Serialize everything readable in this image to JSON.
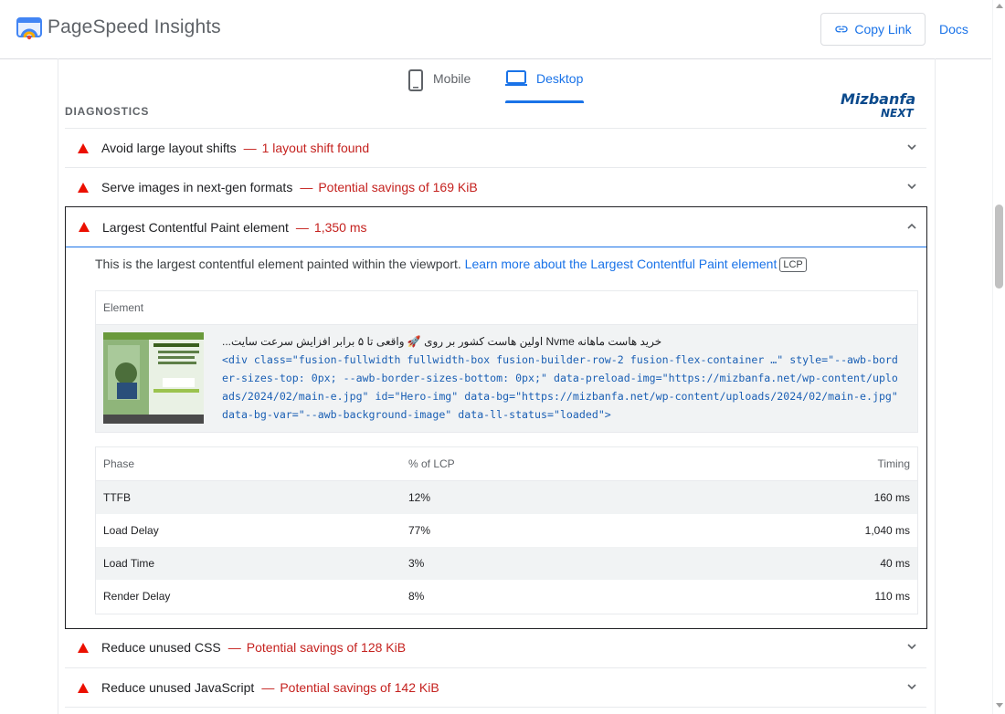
{
  "header": {
    "app_title": "PageSpeed Insights",
    "copy_link_label": "Copy Link",
    "docs_label": "Docs"
  },
  "tabs": [
    {
      "label": "Mobile",
      "icon": "phone-icon",
      "selected": false
    },
    {
      "label": "Desktop",
      "icon": "laptop-icon",
      "selected": true
    }
  ],
  "brand_logo": {
    "line1": "Mizbanfa",
    "line2": "NEXT"
  },
  "diagnostics": {
    "section_title": "DIAGNOSTICS",
    "audits": [
      {
        "title": "Avoid large layout shifts",
        "detail": "1 layout shift found",
        "expanded": false
      },
      {
        "title": "Serve images in next-gen formats",
        "detail": "Potential savings of 169 KiB",
        "expanded": false
      },
      {
        "title": "Largest Contentful Paint element",
        "detail": "1,350 ms",
        "expanded": true
      },
      {
        "title": "Reduce unused CSS",
        "detail": "Potential savings of 128 KiB",
        "expanded": false
      },
      {
        "title": "Reduce unused JavaScript",
        "detail": "Potential savings of 142 KiB",
        "expanded": false
      }
    ],
    "separator": "—",
    "status_color": "#eb0f00"
  },
  "lcp_detail": {
    "description": "This is the largest contentful element painted within the viewport.",
    "learn_more": "Learn more about the Largest Contentful Paint element",
    "badge": "LCP",
    "element_header": "Element",
    "element_label": "خرید هاست ماهانه Nvme اولین هاست کشور بر روی 🚀 واقعی تا ۵ برابر افزایش سرعت سایت...",
    "element_code": "<div class=\"fusion-fullwidth fullwidth-box fusion-builder-row-2 fusion-flex-container …\" style=\"--awb-border-sizes-top: 0px; --awb-border-sizes-bottom: 0px;\" data-preload-img=\"https://mizbanfa.net/wp-content/uploads/2024/02/main-e.jpg\" id=\"Hero-img\" data-bg=\"https://mizbanfa.net/wp-content/uploads/2024/02/main-e.jpg\" data-bg-var=\"--awb-background-image\" data-ll-status=\"loaded\">",
    "phase_table": {
      "headers": [
        "Phase",
        "% of LCP",
        "Timing"
      ],
      "rows": [
        [
          "TTFB",
          "12%",
          "160 ms"
        ],
        [
          "Load Delay",
          "77%",
          "1,040 ms"
        ],
        [
          "Load Time",
          "3%",
          "40 ms"
        ],
        [
          "Render Delay",
          "8%",
          "110 ms"
        ]
      ]
    }
  },
  "colors": {
    "accent": "#1a73e8",
    "fail_text": "#c5221f"
  }
}
